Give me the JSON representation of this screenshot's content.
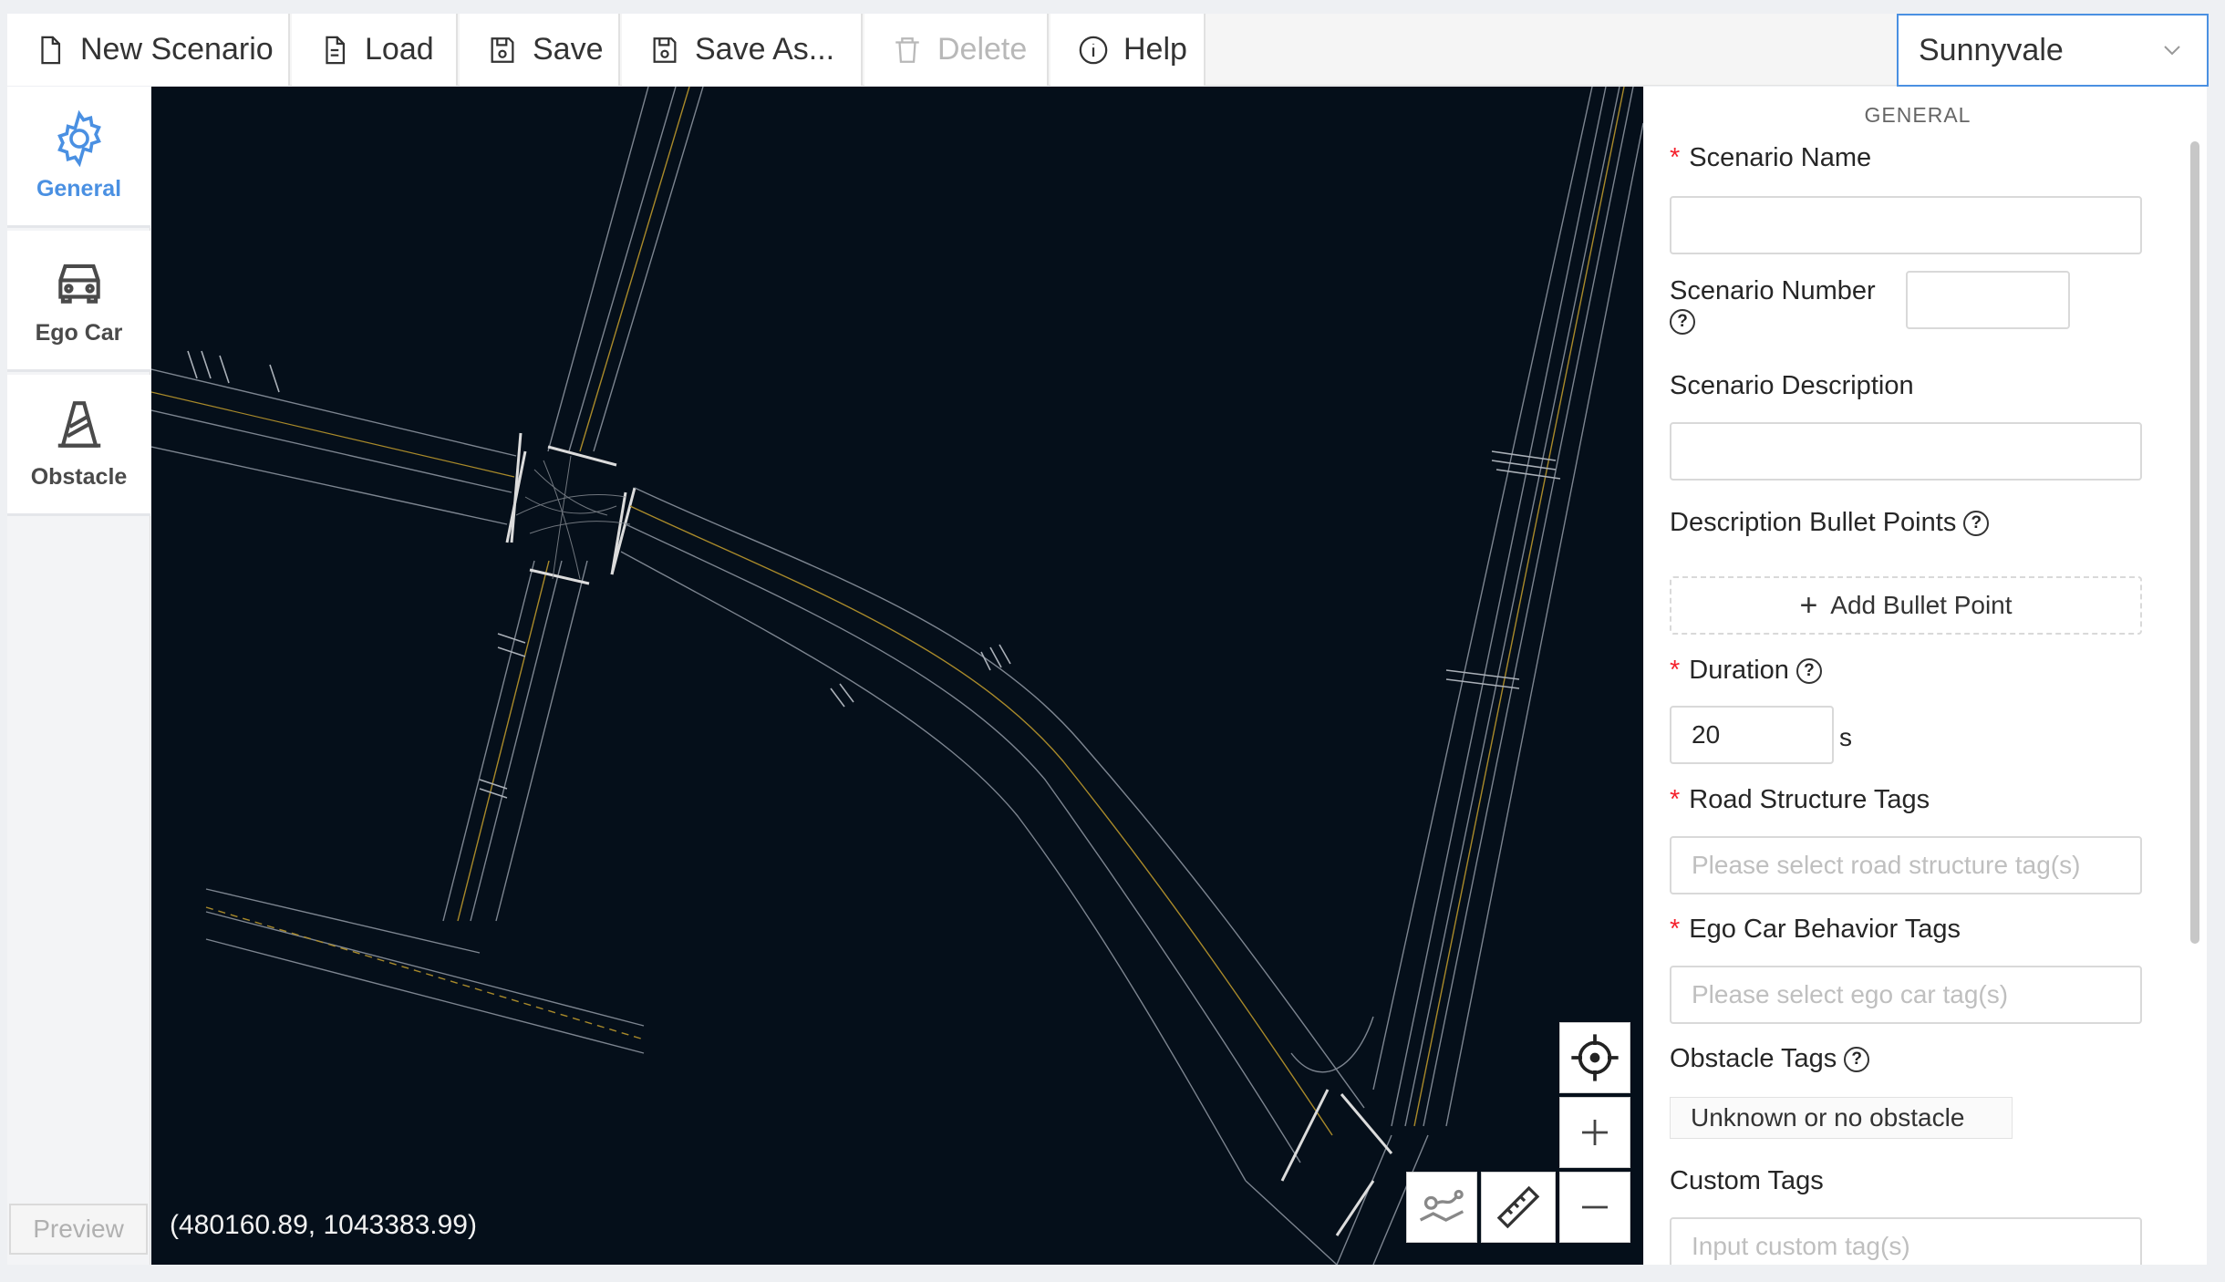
{
  "toolbar": {
    "new_scenario": "New Scenario",
    "load": "Load",
    "save": "Save",
    "save_as": "Save As...",
    "delete": "Delete",
    "help": "Help"
  },
  "city_select": {
    "value": "Sunnyvale"
  },
  "sidebar": {
    "items": [
      {
        "label": "General",
        "icon": "gear-icon",
        "active": true
      },
      {
        "label": "Ego Car",
        "icon": "car-icon",
        "active": false
      },
      {
        "label": "Obstacle",
        "icon": "traffic-cone-icon",
        "active": false
      }
    ],
    "preview": "Preview"
  },
  "map": {
    "coordinates": "(480160.89, 1043383.99)",
    "colors": {
      "background": "#050f1a",
      "road_line": "#7d8590",
      "center_line": "#a98a2a"
    }
  },
  "panel": {
    "title": "GENERAL",
    "scenario_name": {
      "label": "Scenario Name",
      "value": ""
    },
    "scenario_number": {
      "label": "Scenario Number",
      "value": ""
    },
    "scenario_description": {
      "label": "Scenario Description",
      "value": ""
    },
    "bullet_points": {
      "label": "Description Bullet Points",
      "button": "Add Bullet Point"
    },
    "duration": {
      "label": "Duration",
      "value": "20",
      "unit": "s"
    },
    "road_structure_tags": {
      "label": "Road Structure Tags",
      "placeholder": "Please select road structure tag(s)"
    },
    "ego_car_behavior_tags": {
      "label": "Ego Car Behavior Tags",
      "placeholder": "Please select ego car tag(s)"
    },
    "obstacle_tags": {
      "label": "Obstacle Tags",
      "selected": "Unknown or no obstacle"
    },
    "custom_tags": {
      "label": "Custom Tags",
      "placeholder": "Input custom tag(s)"
    }
  }
}
